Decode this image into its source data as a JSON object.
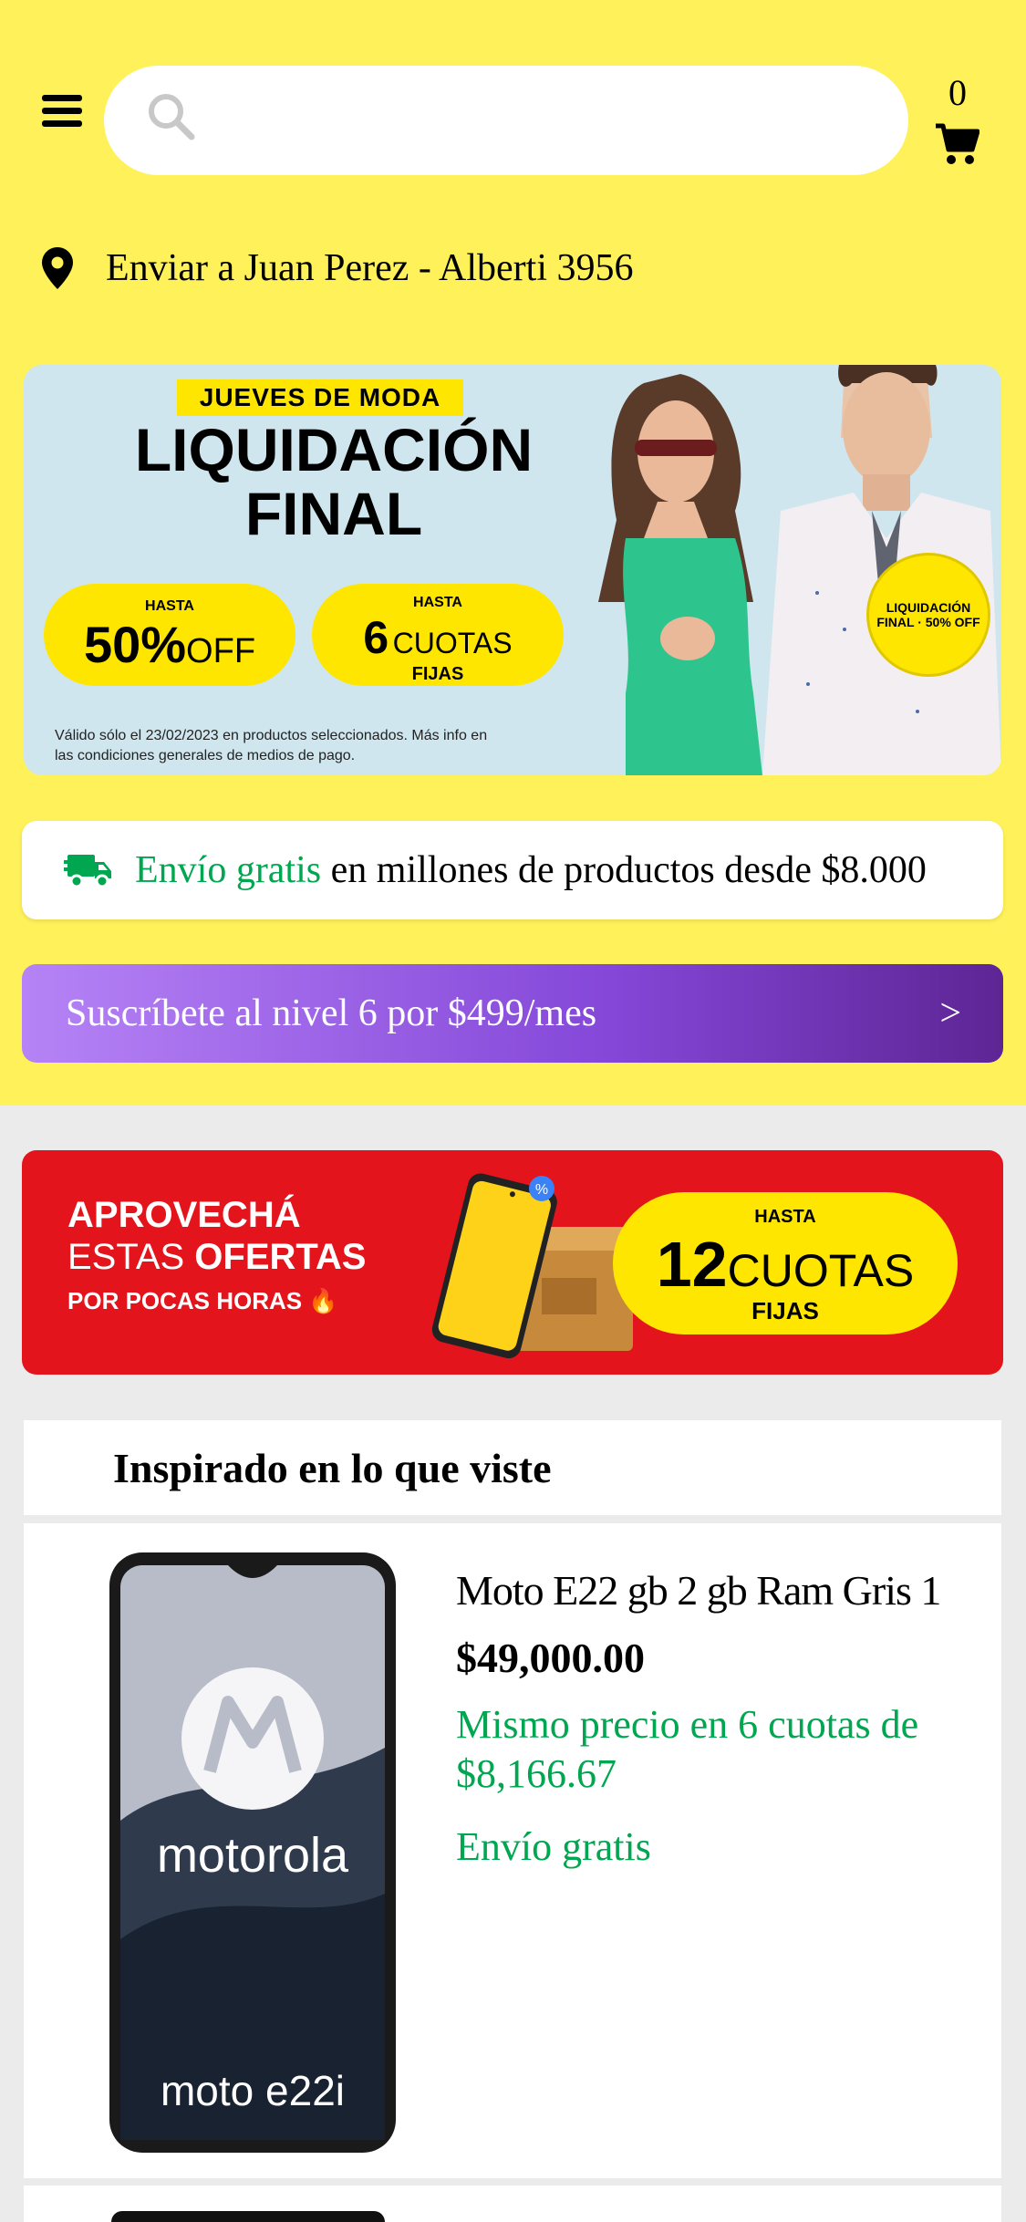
{
  "header": {
    "search_placeholder": "",
    "cart_count": "0",
    "location": "Enviar a Juan Perez - Alberti 3956"
  },
  "hero_banner": {
    "badge": "JUEVES DE MODA",
    "title_line1": "LIQUIDACIÓN",
    "title_line2": "FINAL",
    "pill1_small": "HASTA",
    "pill1_big": "50%",
    "pill1_rest": "OFF",
    "pill2_small": "HASTA",
    "pill2_big": "6",
    "pill2_rest": "CUOTAS",
    "pill2_sub": "FIJAS",
    "seal_text": "LIQUIDACIÓN FINAL · 50% OFF",
    "legal_line1": "Válido sólo el 23/02/2023 en productos seleccionados. Más info en",
    "legal_line2": "las condiciones generales de medios de pago."
  },
  "shipping_card": {
    "green_text": "Envío gratis",
    "text": " en millones de productos desde $8.000",
    "icon": "truck-icon"
  },
  "subscribe_card": {
    "text": "Suscríbete al nivel 6 por $499/mes",
    "arrow": ">"
  },
  "offers_banner": {
    "line1": "APROVECHÁ",
    "line2_thin": "ESTAS ",
    "line2_bold": "OFERTAS",
    "line3": "POR POCAS HORAS 🔥",
    "pill_small": "HASTA",
    "pill_big": "12",
    "pill_rest": "CUOTAS",
    "pill_sub": "FIJAS"
  },
  "section": {
    "title": "Inspirado en lo que viste"
  },
  "product": {
    "title": "Moto E22 gb 2 gb Ram Gris 1",
    "price": "$49,000.00",
    "installments": "Mismo precio en 6 cuotas de $8,166.67",
    "shipping": "Envío gratis",
    "brand_text": "motorola",
    "model_text": "moto e22i"
  },
  "colors": {
    "header_bg": "#fff159",
    "green": "#00a650",
    "purple_start": "#b683f6",
    "purple_end": "#5d2594",
    "offer_red": "#e3141b",
    "yellow": "#ffe600"
  }
}
